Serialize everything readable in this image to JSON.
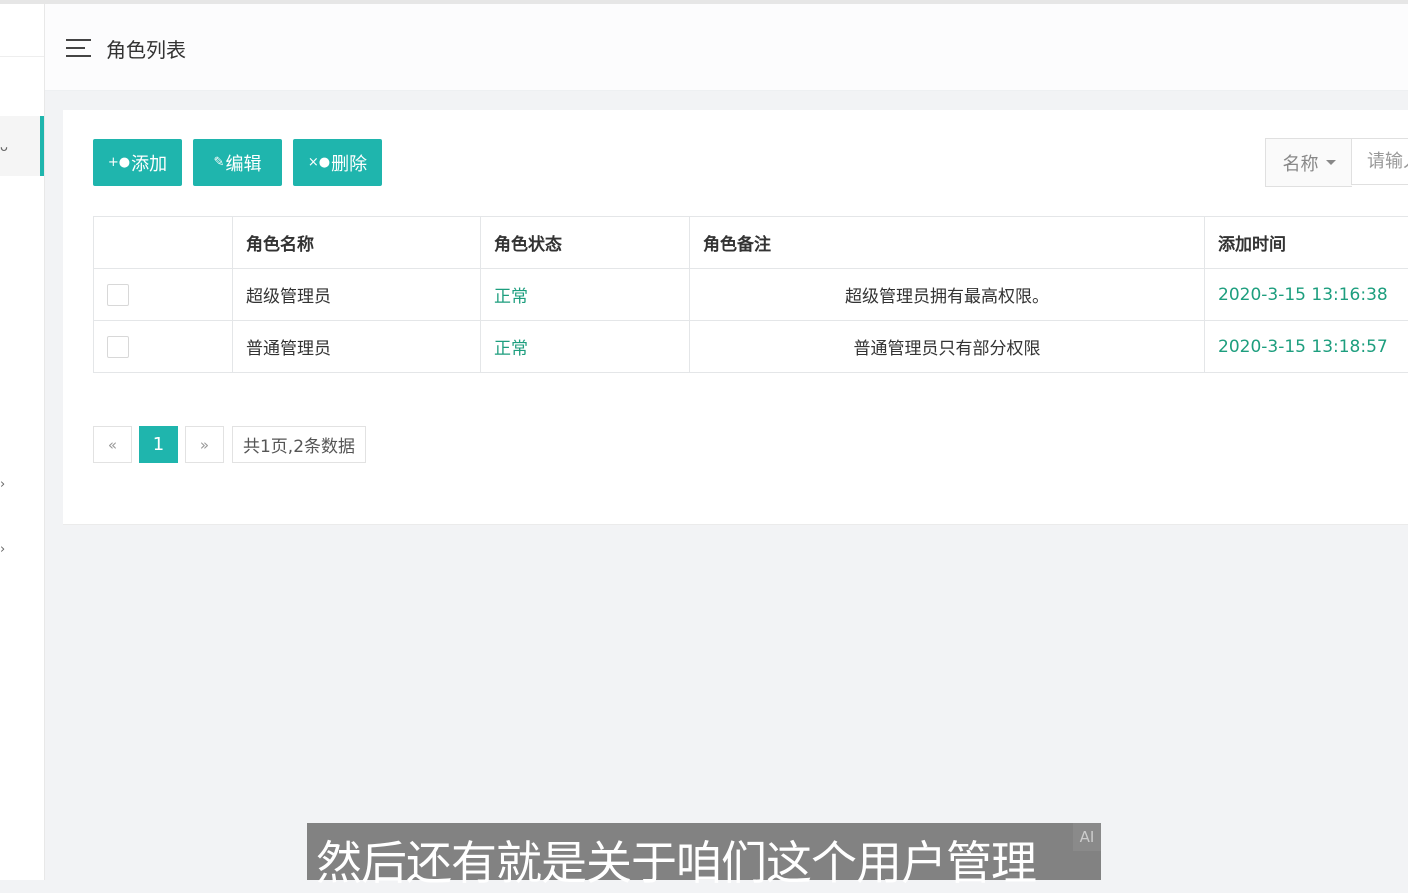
{
  "header": {
    "title": "角色列表"
  },
  "sidebar": {
    "glyphs": [
      "ᴗ",
      "›",
      "›"
    ]
  },
  "toolbar": {
    "add_label": "添加",
    "edit_label": "编辑",
    "delete_label": "删除"
  },
  "search": {
    "field_label": "名称",
    "placeholder": "请输入"
  },
  "table": {
    "columns": [
      "角色名称",
      "角色状态",
      "角色备注",
      "添加时间"
    ],
    "rows": [
      {
        "name": "超级管理员",
        "status": "正常",
        "remark": "超级管理员拥有最高权限。",
        "time": "2020-3-15 13:16:38"
      },
      {
        "name": "普通管理员",
        "status": "正常",
        "remark": "普通管理员只有部分权限",
        "time": "2020-3-15 13:18:57"
      }
    ]
  },
  "pagination": {
    "prev": "«",
    "current": "1",
    "next": "»",
    "info": "共1页,2条数据"
  },
  "subtitle": {
    "text": "然后还有就是关于咱们这个用户管理",
    "badge": "AI"
  },
  "colors": {
    "accent": "#1fb5ad",
    "status_green": "#1d9e7e"
  }
}
